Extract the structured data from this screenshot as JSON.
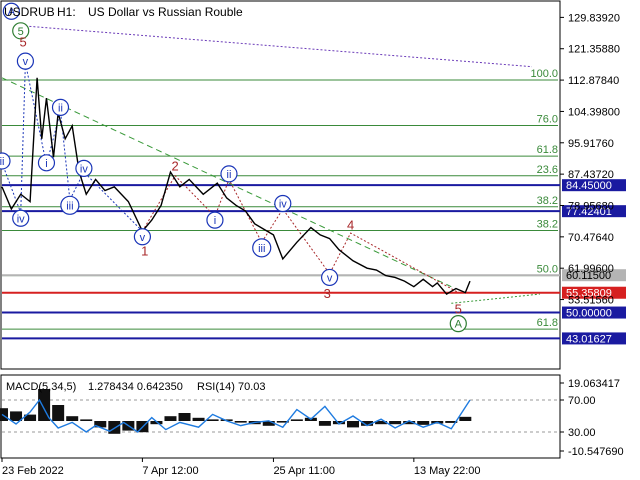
{
  "header": {
    "symbol": "USDRUB",
    "timeframe": "H1:",
    "description": "US Dollar vs Russian Rouble"
  },
  "indicator": {
    "label": "MACD(5,34,5)",
    "values": "1.278434 0.642350",
    "rsi_label": "RSI(14) 70.03"
  },
  "colors": {
    "price": "#000000",
    "wave_blue": "#1a35b8",
    "wave_red": "#a8282a",
    "wave_green": "#2e7d32",
    "fib_green": "#3a8a3a",
    "level_blue": "#1a1aa0",
    "level_red": "#d62020",
    "rsi": "#1e7be0"
  },
  "chart_data": {
    "type": "line",
    "y_axis": {
      "ticks": [
        "129.83920",
        "121.35880",
        "112.87840",
        "104.39800",
        "95.91760",
        "87.43720",
        "78.95680",
        "70.47640",
        "61.99600",
        "53.51560"
      ],
      "range": [
        35,
        134
      ]
    },
    "x_axis": {
      "labels": [
        "23 Feb 2022",
        "7 Apr 12:00",
        "25 Apr 11:00",
        "13 May 22:00"
      ],
      "positions": [
        0.0,
        0.3,
        0.58,
        0.88
      ],
      "range": [
        0,
        1
      ]
    },
    "price_series": {
      "x": [
        0.0,
        0.02,
        0.04,
        0.06,
        0.075,
        0.085,
        0.095,
        0.11,
        0.12,
        0.135,
        0.15,
        0.165,
        0.18,
        0.2,
        0.22,
        0.24,
        0.27,
        0.3,
        0.32,
        0.34,
        0.36,
        0.38,
        0.4,
        0.43,
        0.46,
        0.48,
        0.5,
        0.52,
        0.54,
        0.56,
        0.58,
        0.6,
        0.63,
        0.66,
        0.68,
        0.7,
        0.72,
        0.75,
        0.78,
        0.8,
        0.82,
        0.84,
        0.86,
        0.88,
        0.9,
        0.92,
        0.93,
        0.95,
        0.97,
        0.99,
        1.0
      ],
      "y": [
        84.0,
        78.0,
        82.0,
        80.0,
        113.5,
        97.0,
        108.0,
        92.0,
        104.0,
        97.0,
        100.5,
        88.0,
        82.0,
        86.0,
        83.0,
        84.0,
        80.0,
        72.0,
        75.0,
        79.0,
        88.0,
        84.0,
        86.0,
        82.0,
        85.0,
        81.0,
        79.0,
        77.5,
        74.0,
        72.5,
        71.0,
        64.5,
        69.0,
        73.0,
        71.0,
        70.0,
        67.0,
        64.0,
        62.0,
        61.5,
        60.0,
        59.5,
        58.5,
        57.0,
        59.0,
        57.0,
        58.0,
        55.0,
        56.5,
        55.4,
        58.5
      ]
    },
    "horizontal_levels": [
      {
        "label": "84.45000",
        "value": 84.45,
        "color": "#1a1aa0"
      },
      {
        "label": "77.42401",
        "value": 77.42,
        "color": "#1a1aa0"
      },
      {
        "label": "60.11500",
        "value": 60.1,
        "color": "#b4b4b4"
      },
      {
        "label": "55.35809",
        "value": 55.36,
        "color": "#d62020"
      },
      {
        "label": "50.00000",
        "value": 50.0,
        "color": "#1a1aa0"
      },
      {
        "label": "43.01627",
        "value": 43.0,
        "color": "#1a1aa0"
      }
    ],
    "fibonacci_levels": [
      {
        "label": "100.0",
        "value": 112.9
      },
      {
        "label": "76.0",
        "value": 100.6
      },
      {
        "label": "61.8",
        "value": 92.3
      },
      {
        "label": "23.6",
        "value": 87.0
      },
      {
        "label": "38.2",
        "value": 78.6
      },
      {
        "label": "38.2",
        "value": 72.2
      },
      {
        "label": "50.0",
        "value": 60.0
      },
      {
        "label": "61.8",
        "value": 45.5
      }
    ],
    "wave_labels": [
      {
        "text": "A",
        "x": 0.02,
        "y": 131.5,
        "color": "#1a35b8",
        "circled": true
      },
      {
        "text": "5",
        "x": 0.04,
        "y": 126.2,
        "color": "#2e7d32",
        "circled": true
      },
      {
        "text": "5",
        "x": 0.045,
        "y": 123.0,
        "color": "#a8282a",
        "circled": false
      },
      {
        "text": "v",
        "x": 0.05,
        "y": 118.0,
        "color": "#1a35b8",
        "circled": true
      },
      {
        "text": "ii",
        "x": 0.0,
        "y": 91.0,
        "color": "#1a35b8",
        "circled": true
      },
      {
        "text": "iv",
        "x": 0.04,
        "y": 75.5,
        "color": "#1a35b8",
        "circled": true
      },
      {
        "text": "i",
        "x": 0.095,
        "y": 90.5,
        "color": "#1a35b8",
        "circled": true
      },
      {
        "text": "ii",
        "x": 0.125,
        "y": 105.5,
        "color": "#1a35b8",
        "circled": true
      },
      {
        "text": "iii",
        "x": 0.145,
        "y": 79.0,
        "color": "#1a35b8",
        "circled": true
      },
      {
        "text": "iv",
        "x": 0.175,
        "y": 89.0,
        "color": "#1a35b8",
        "circled": true
      },
      {
        "text": "v",
        "x": 0.3,
        "y": 70.5,
        "color": "#1a35b8",
        "circled": true
      },
      {
        "text": "1",
        "x": 0.305,
        "y": 66.5,
        "color": "#a8282a",
        "circled": false
      },
      {
        "text": "2",
        "x": 0.37,
        "y": 89.5,
        "color": "#a8282a",
        "circled": false
      },
      {
        "text": "ii",
        "x": 0.485,
        "y": 87.5,
        "color": "#1a35b8",
        "circled": true
      },
      {
        "text": "i",
        "x": 0.455,
        "y": 75.0,
        "color": "#1a35b8",
        "circled": true
      },
      {
        "text": "iv",
        "x": 0.6,
        "y": 79.5,
        "color": "#1a35b8",
        "circled": true
      },
      {
        "text": "iii",
        "x": 0.555,
        "y": 67.5,
        "color": "#1a35b8",
        "circled": true
      },
      {
        "text": "4",
        "x": 0.745,
        "y": 73.5,
        "color": "#a8282a",
        "circled": false
      },
      {
        "text": "v",
        "x": 0.7,
        "y": 59.5,
        "color": "#1a35b8",
        "circled": true
      },
      {
        "text": "3",
        "x": 0.695,
        "y": 55.0,
        "color": "#a8282a",
        "circled": false
      },
      {
        "text": "5",
        "x": 0.975,
        "y": 50.8,
        "color": "#a8282a",
        "circled": false
      },
      {
        "text": "A",
        "x": 0.975,
        "y": 47.0,
        "color": "#2e7d32",
        "circled": true
      }
    ],
    "macd_panel": {
      "y_axis": {
        "ticks": [
          "19.063417",
          "70.00",
          "30.00",
          "-10.547690"
        ],
        "range": [
          -10.54769,
          19.063417
        ]
      },
      "histogram": {
        "x": [
          0.0,
          0.03,
          0.06,
          0.09,
          0.12,
          0.15,
          0.18,
          0.21,
          0.24,
          0.27,
          0.3,
          0.33,
          0.36,
          0.39,
          0.42,
          0.45,
          0.48,
          0.51,
          0.54,
          0.57,
          0.6,
          0.63,
          0.66,
          0.69,
          0.72,
          0.75,
          0.78,
          0.81,
          0.84,
          0.87,
          0.9,
          0.93,
          0.96,
          0.99
        ],
        "y": [
          4.0,
          3.0,
          2.0,
          10.0,
          5.0,
          1.5,
          0.5,
          -2.0,
          -4.0,
          -3.0,
          -3.5,
          -1.0,
          1.5,
          2.5,
          1.0,
          0.5,
          0.5,
          -0.5,
          -1.0,
          -1.5,
          -0.5,
          0.5,
          1.0,
          -1.5,
          -1.0,
          -2.0,
          -1.5,
          -1.0,
          -1.0,
          -1.0,
          -1.2,
          -0.8,
          -0.6,
          1.3
        ]
      },
      "rsi": {
        "x": [
          0.0,
          0.03,
          0.06,
          0.08,
          0.1,
          0.12,
          0.15,
          0.18,
          0.2,
          0.23,
          0.26,
          0.29,
          0.32,
          0.35,
          0.38,
          0.42,
          0.45,
          0.48,
          0.51,
          0.54,
          0.57,
          0.6,
          0.63,
          0.66,
          0.69,
          0.72,
          0.75,
          0.78,
          0.81,
          0.84,
          0.87,
          0.9,
          0.93,
          0.96,
          1.0
        ],
        "y": [
          52.0,
          40.0,
          55.0,
          70.0,
          48.0,
          35.0,
          42.0,
          30.0,
          38.0,
          31.0,
          42.0,
          30.0,
          48.0,
          33.0,
          42.0,
          36.0,
          52.0,
          44.0,
          38.0,
          42.0,
          44.0,
          36.0,
          58.0,
          46.0,
          62.0,
          40.0,
          50.0,
          38.0,
          46.0,
          35.0,
          44.0,
          36.0,
          42.0,
          34.0,
          70.03
        ]
      }
    }
  }
}
